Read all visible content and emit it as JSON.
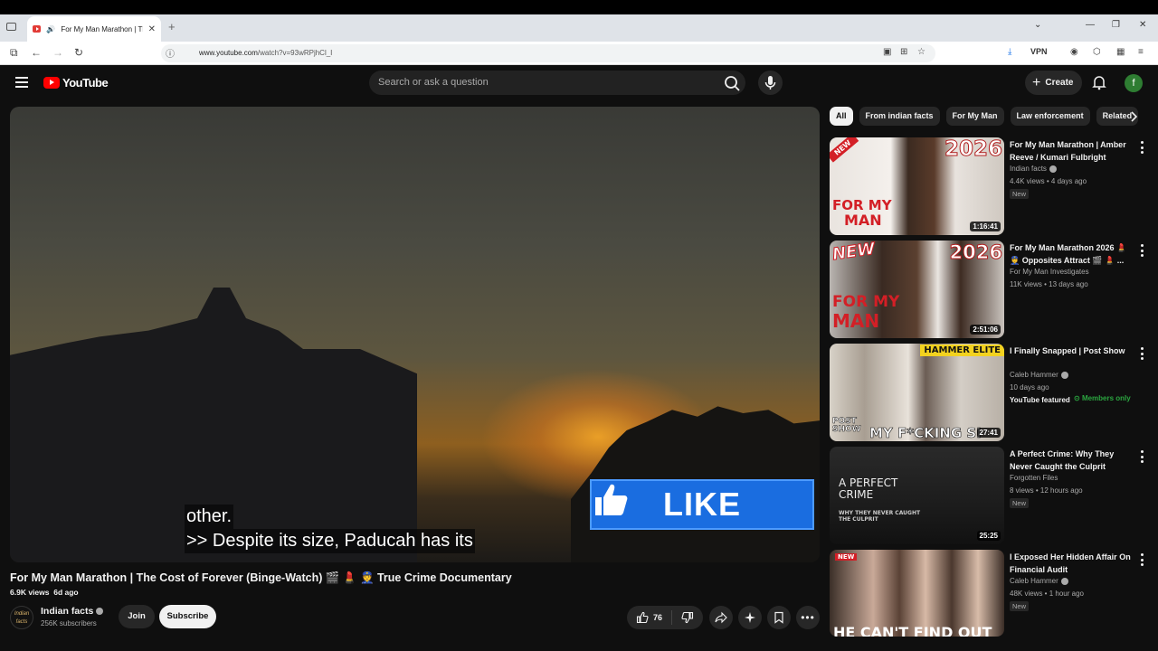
{
  "browser": {
    "tab_title": "For My Man Marathon | The",
    "tab_close": "✕",
    "new_tab": "+",
    "url_site": "www.youtube.com",
    "url_path": "/watch?v=93wRPjhCl_I",
    "vpn_label": "VPN",
    "minimize": "—",
    "restore": "❐",
    "close": "✕"
  },
  "header": {
    "logo_text": "YouTube",
    "search_placeholder": "Search or ask a question",
    "create_label": "Create",
    "avatar_letter": "f"
  },
  "player": {
    "caption_line1": "other.",
    "caption_line2": ">> Despite its size, Paducah has its",
    "overlay_text": "LIKE"
  },
  "video": {
    "title": "For My Man Marathon | The Cost of Forever (Binge-Watch) 🎬 💄 👮 True Crime Documentary",
    "views": "6.9K views",
    "age": "6d ago",
    "channel_name": "Indian facts",
    "channel_avatar_text": "Indian facts",
    "subscribers": "256K subscribers",
    "join_label": "Join",
    "subscribe_label": "Subscribe",
    "like_count": "76"
  },
  "chips": [
    "All",
    "From indian facts",
    "For My Man",
    "Law enforcement",
    "Related"
  ],
  "recommendations": [
    {
      "title": "For My Man Marathon | Amber Reeve / Kumari Fulbright (Binge...",
      "channel": "Indian facts",
      "verified": true,
      "meta": "4.4K views • 4 days ago",
      "badge": "New",
      "duration": "1:16:41",
      "thumb_top": "2026",
      "thumb_corner": "NEW",
      "thumb_bottom1": "FOR MY",
      "thumb_bottom2": "MAN"
    },
    {
      "title": "For My Man Marathon 2026 💄 👮 Opposites Attract 🎬 💄 ...",
      "channel": "For My Man Investigates",
      "verified": false,
      "meta": "11K views • 13 days ago",
      "badge": "",
      "duration": "2:51:06",
      "thumb_top": "2026",
      "thumb_corner": "NEW",
      "thumb_bottom1": "FOR MY",
      "thumb_bottom2": "MAN"
    },
    {
      "title": "I Finally Snapped | Post Show",
      "channel": "Caleb Hammer",
      "verified": true,
      "meta": "10 days ago",
      "featured": "YouTube featured",
      "members": "Members only",
      "duration": "27:41",
      "thumb_top": "HAMMER ELITE",
      "thumb_bottom1": "POST SHOW",
      "thumb_bottom2": "MY F*CKING SI"
    },
    {
      "title": "A Perfect Crime: Why They Never Caught the Culprit",
      "channel": "Forgotten Files",
      "verified": false,
      "meta": "8 views • 12 hours ago",
      "badge": "New",
      "duration": "25:25",
      "thumb_top": "A PERFECT CRIME",
      "thumb_bottom1": "WHY THEY NEVER CAUGHT THE CULPRIT"
    },
    {
      "title": "I Exposed Her Hidden Affair On Financial Audit",
      "channel": "Caleb Hammer",
      "verified": true,
      "meta": "48K views • 1 hour ago",
      "badge": "New",
      "thumb_corner": "NEW",
      "thumb_bottom1": "HE CAN'T FIND OUT"
    }
  ],
  "colors": {
    "brand_red": "#ff0000",
    "background": "#0f0f0f",
    "chip_bg": "#272727",
    "members_green": "#2ba640",
    "like_blue": "#1a6de0"
  }
}
